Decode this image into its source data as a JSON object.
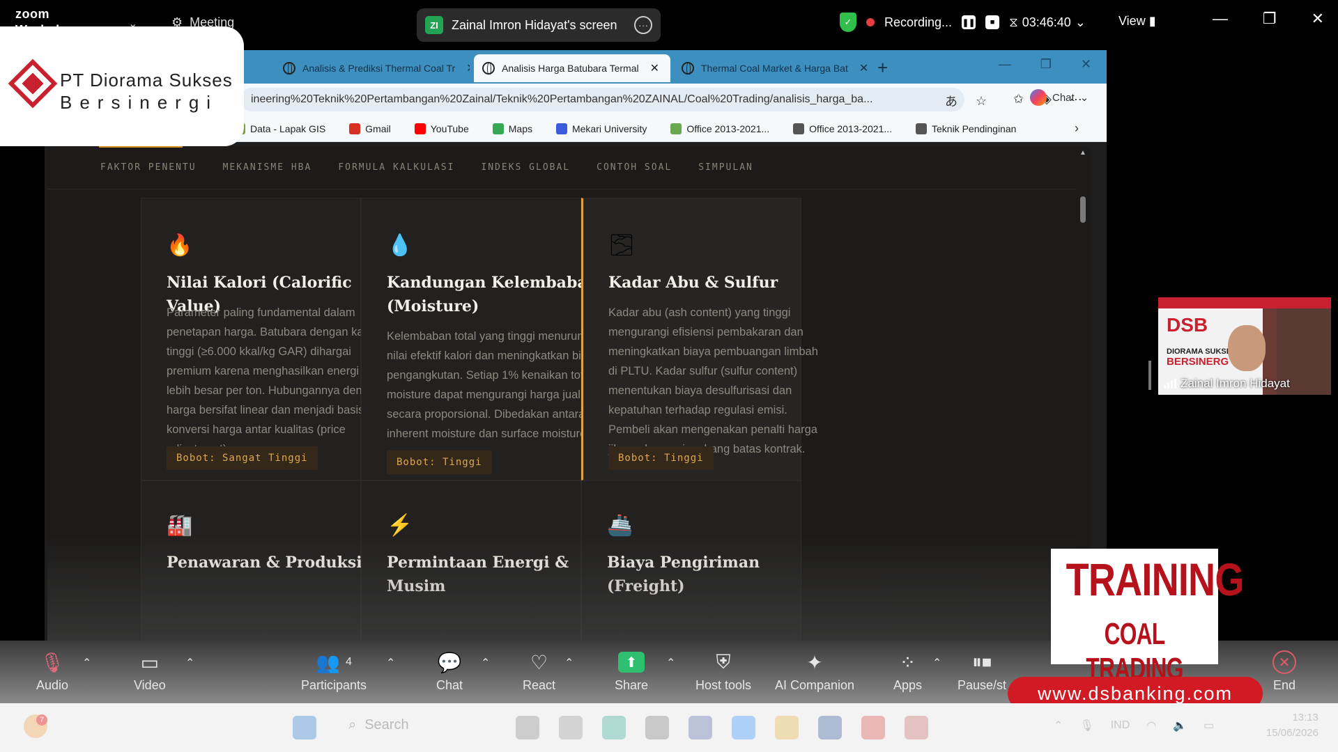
{
  "zoom": {
    "brand": "zoom",
    "brand_sub": "Workplace",
    "meeting_label": "Meeting",
    "share_initials": "ZI",
    "share_title": "Zainal Imron Hidayat's screen",
    "recording_label": "Recording...",
    "timer": "03:46:40",
    "view_label": "View",
    "toolbar": [
      {
        "key": "audio",
        "label": "Audio"
      },
      {
        "key": "video",
        "label": "Video"
      },
      {
        "key": "participants",
        "label": "Participants",
        "count": "4"
      },
      {
        "key": "chat",
        "label": "Chat"
      },
      {
        "key": "react",
        "label": "React"
      },
      {
        "key": "share",
        "label": "Share"
      },
      {
        "key": "host",
        "label": "Host tools"
      },
      {
        "key": "ai",
        "label": "AI Companion"
      },
      {
        "key": "apps",
        "label": "Apps"
      },
      {
        "key": "pause",
        "label": "Pause/st"
      },
      {
        "key": "end",
        "label": "End"
      }
    ]
  },
  "browser": {
    "tabs": [
      {
        "title": "Analisis & Prediksi Thermal Coal Tr",
        "active": false
      },
      {
        "title": "Analisis Harga Batubara Termal",
        "active": true
      },
      {
        "title": "Thermal Coal Market & Harga Bat",
        "active": false
      }
    ],
    "url": "ineering%20Teknik%20Pertambangan%20Zainal/Teknik%20Pertambangan%20ZAINAL/Coal%20Trading/analisis_harga_ba...",
    "chat_label": "Chat",
    "bookmarks": [
      {
        "label": "Data - Lapak GIS",
        "color": "#7a9e3c"
      },
      {
        "label": "Gmail",
        "color": "#d93025"
      },
      {
        "label": "YouTube",
        "color": "#ff0000"
      },
      {
        "label": "Maps",
        "color": "#34a853"
      },
      {
        "label": "Mekari University",
        "color": "#3b5bdb"
      },
      {
        "label": "Office 2013-2021...",
        "color": "#6aa84f"
      },
      {
        "label": "Office 2013-2021...",
        "color": "#555555"
      },
      {
        "label": "Teknik Pendinginan",
        "color": "#555555"
      }
    ]
  },
  "page": {
    "nav": [
      "FAKTOR PENENTU",
      "MEKANISME HBA",
      "FORMULA KALKULASI",
      "INDEKS GLOBAL",
      "CONTOH SOAL",
      "SIMPULAN"
    ],
    "cards": [
      {
        "icon": "🔥",
        "title": "Nilai Kalori (Calorific Value)",
        "text": "Parameter paling fundamental dalam penetapan harga. Batubara dengan kalori tinggi (≥6.000 kkal/kg GAR) dihargai premium karena menghasilkan energi lebih besar per ton. Hubungannya dengan harga bersifat linear dan menjadi basis konversi harga antar kualitas (price adjustment).",
        "badge": "Bobot: Sangat Tinggi"
      },
      {
        "icon": "💧",
        "title": "Kandungan Kelembaban (Moisture)",
        "text": "Kelembaban total yang tinggi menurunkan nilai efektif kalori dan meningkatkan biaya pengangkutan. Setiap 1% kenaikan total moisture dapat mengurangi harga jual secara proporsional. Dibedakan antara inherent moisture dan surface moisture.",
        "badge": "Bobot: Tinggi"
      },
      {
        "icon": "🌫",
        "title": "Kadar Abu & Sulfur",
        "text": "Kadar abu (ash content) yang tinggi mengurangi efisiensi pembakaran dan meningkatkan biaya pembuangan limbah di PLTU. Kadar sulfur (sulfur content) menentukan biaya desulfurisasi dan kepatuhan terhadap regulasi emisi. Pembeli akan mengenakan penalti harga jika melampaui ambang batas kontrak.",
        "badge": "Bobot: Tinggi"
      },
      {
        "icon": "🏭",
        "title": "Penawaran & Produksi"
      },
      {
        "icon": "⚡",
        "title": "Permintaan Energi & Musim"
      },
      {
        "icon": "🚢",
        "title": "Biaya Pengiriman (Freight)"
      }
    ]
  },
  "overlays": {
    "company_line1": "PT Diorama  Sukses",
    "company_line2": "Bersinergi",
    "participant_name": "Zainal Imron Hidayat",
    "video_logo": "DSB",
    "video_sub1": "DIORAMA SUKSE",
    "video_sub2": "BERSINERG",
    "training_line1": "TRAINING",
    "training_line2": "COAL TRADING",
    "website": "www.dsbanking.com"
  },
  "taskbar": {
    "search_placeholder": "Search",
    "notify_count": "7",
    "lang": "IND",
    "time": "13:13",
    "date": "15/06/2026"
  }
}
